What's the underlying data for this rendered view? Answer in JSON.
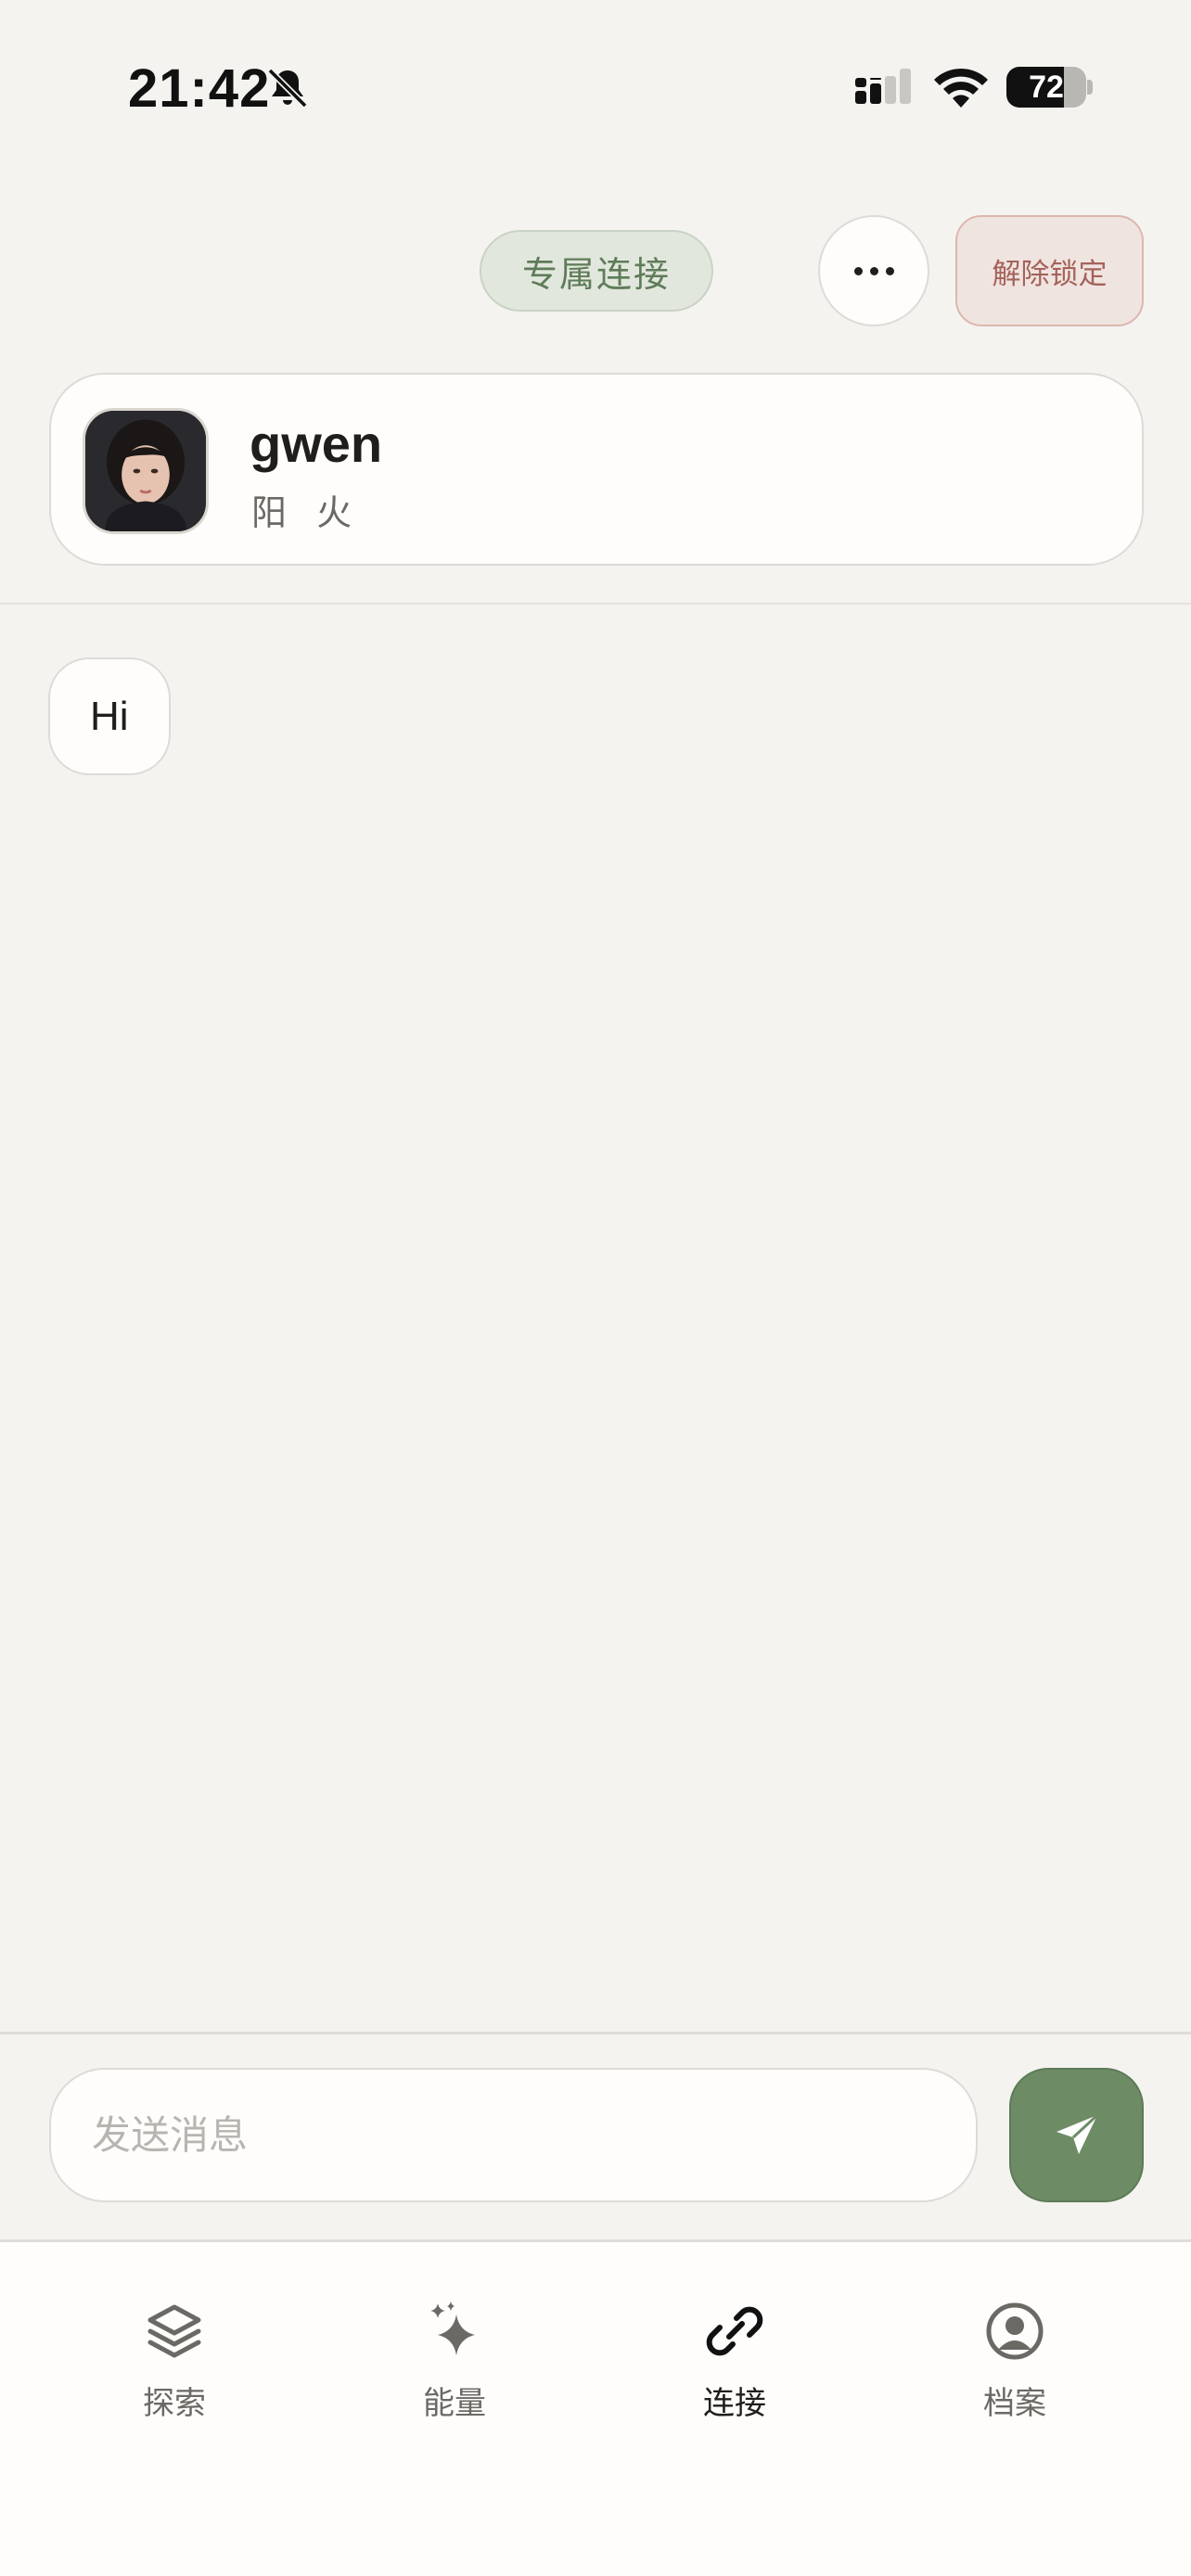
{
  "status_bar": {
    "time": "21:42",
    "battery_level": "72",
    "battery_fraction": 0.72
  },
  "header": {
    "tag_label": "专属连接",
    "unlock_label": "解除锁定"
  },
  "profile": {
    "name": "gwen",
    "subtitle": "阳 火"
  },
  "messages": [
    {
      "text": "Hi"
    }
  ],
  "composer": {
    "placeholder": "发送消息",
    "value": ""
  },
  "nav": {
    "items": [
      {
        "label": "探索",
        "icon": "layers-icon"
      },
      {
        "label": "能量",
        "icon": "sparkle-icon"
      },
      {
        "label": "连接",
        "icon": "link-icon",
        "active": true
      },
      {
        "label": "档案",
        "icon": "profile-icon"
      }
    ]
  },
  "colors": {
    "background": "#f4f3f0",
    "accent_green": "#6d8c65",
    "tag_green_text": "#5f7c58",
    "unlock_text": "#a5625a"
  }
}
